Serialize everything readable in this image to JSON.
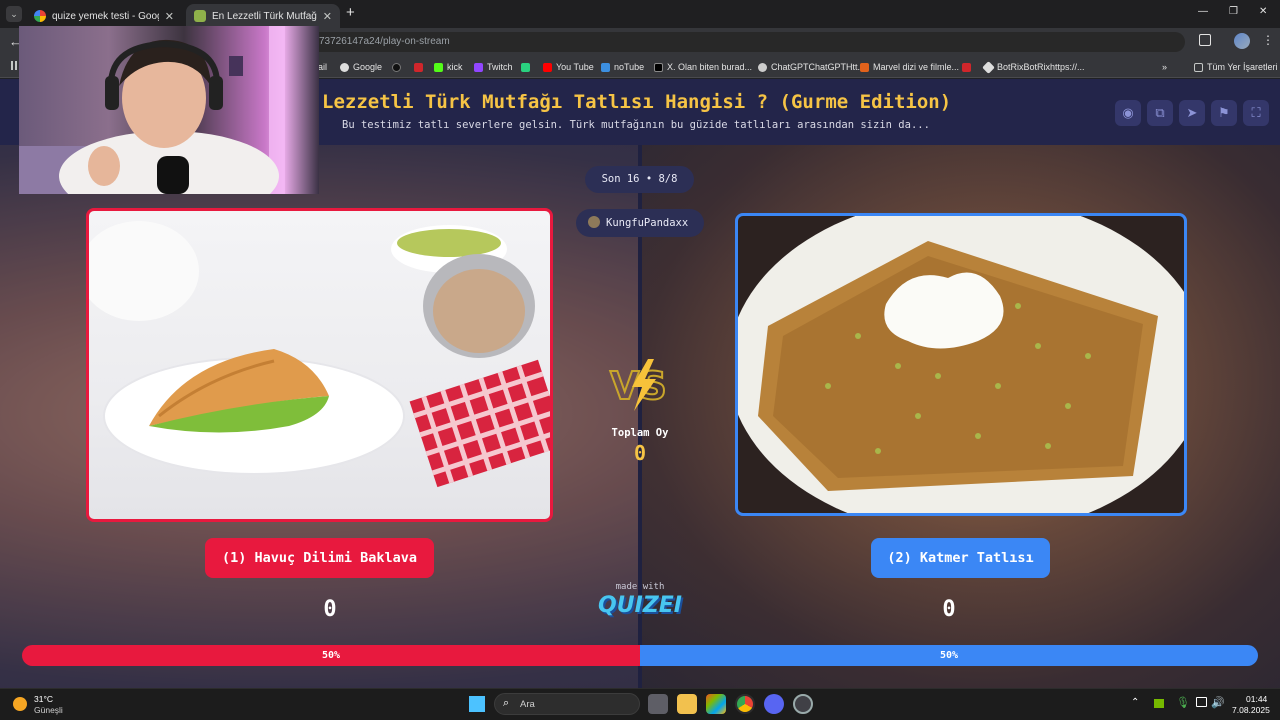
{
  "browser": {
    "tabs": [
      {
        "title": "quize yemek testi - Google'da A",
        "active": false
      },
      {
        "title": "En Lezzetli Türk Mutfağı Tatlısı H",
        "active": true
      }
    ],
    "new_tab": "+",
    "address": "73726147a24/play-on-stream",
    "bookmarks": [
      "ail",
      "Google",
      "kick",
      "Twitch",
      "You Tube",
      "noTube",
      "X. Olan biten burad...",
      "ChatGPTChatGPTHtt...",
      "Marvel dizi ve filmle...",
      "BotRixBotRixhttps://...",
      "Tüm Yer İşaretleri"
    ],
    "window_controls": [
      "—",
      "❐",
      "✕"
    ]
  },
  "quiz": {
    "title": "Lezzetli Türk Mutfağı Tatlısı Hangisi ? (Gurme Edition)",
    "description": "Bu testimiz tatlı severlere gelsin. Türk mutfağının bu güzide tatlıları arasından sizin da...",
    "round": "Son 16 • 8/8",
    "streamer": "KungfuPandaxx",
    "vs": "VS",
    "total_votes_label": "Toplam Oy",
    "total_votes": "0",
    "made_with": "made with",
    "brand": "QUIZEI",
    "options": [
      {
        "label": "(1) Havuç Dilimi Baklava",
        "score": "0",
        "percent": "50%",
        "color": "#e8193e"
      },
      {
        "label": "(2) Katmer Tatlısı",
        "score": "0",
        "percent": "50%",
        "color": "#3b87f5"
      }
    ]
  },
  "taskbar": {
    "weather_temp": "31°C",
    "weather_desc": "Güneşli",
    "search": "Ara",
    "time": "01:44",
    "date": "7.08.2025"
  }
}
